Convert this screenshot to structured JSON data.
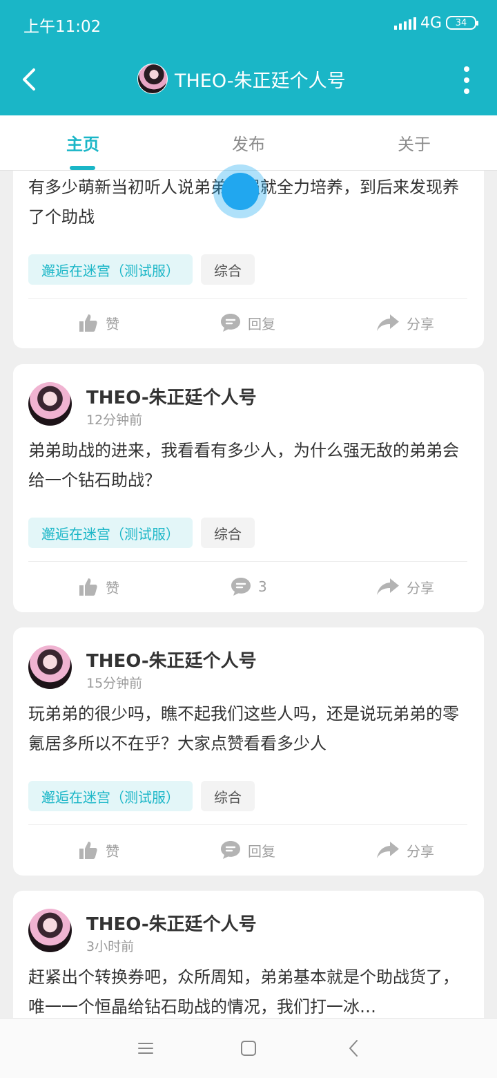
{
  "status_bar": {
    "time": "上午11:02",
    "network": "4G",
    "battery": "34"
  },
  "header": {
    "title": "THEO-朱正廷个人号",
    "back_icon": "chevron-left-icon",
    "more_icon": "more-vertical-icon"
  },
  "tabs": [
    {
      "label": "主页",
      "active": true
    },
    {
      "label": "发布",
      "active": false
    },
    {
      "label": "关于",
      "active": false
    }
  ],
  "posts": [
    {
      "content": "有多少萌新当初听人说弟弟很强就全力培养，到后来发现养了个助战",
      "tags": [
        "邂逅在迷宫（测试服）",
        "综合"
      ],
      "like_label": "赞",
      "comment_label": "回复",
      "share_label": "分享"
    },
    {
      "author": "THEO-朱正廷个人号",
      "time": "12分钟前",
      "content": "弟弟助战的进来，我看看有多少人，为什么强无敌的弟弟会给一个钻石助战？",
      "tags": [
        "邂逅在迷宫（测试服）",
        "综合"
      ],
      "like_label": "赞",
      "comment_label": "3",
      "share_label": "分享"
    },
    {
      "author": "THEO-朱正廷个人号",
      "time": "15分钟前",
      "content": "玩弟弟的很少吗，瞧不起我们这些人吗，还是说玩弟弟的零氪居多所以不在乎？大家点赞看看多少人",
      "tags": [
        "邂逅在迷宫（测试服）",
        "综合"
      ],
      "like_label": "赞",
      "comment_label": "回复",
      "share_label": "分享"
    },
    {
      "author": "THEO-朱正廷个人号",
      "time": "3小时前",
      "content": "赶紧出个转换券吧，众所周知，弟弟基本就是个助战货了，唯一一个恒晶给钻石助战的情况，我们打一冰…"
    }
  ],
  "colors": {
    "accent": "#1ab6c7",
    "background": "#efefef"
  }
}
